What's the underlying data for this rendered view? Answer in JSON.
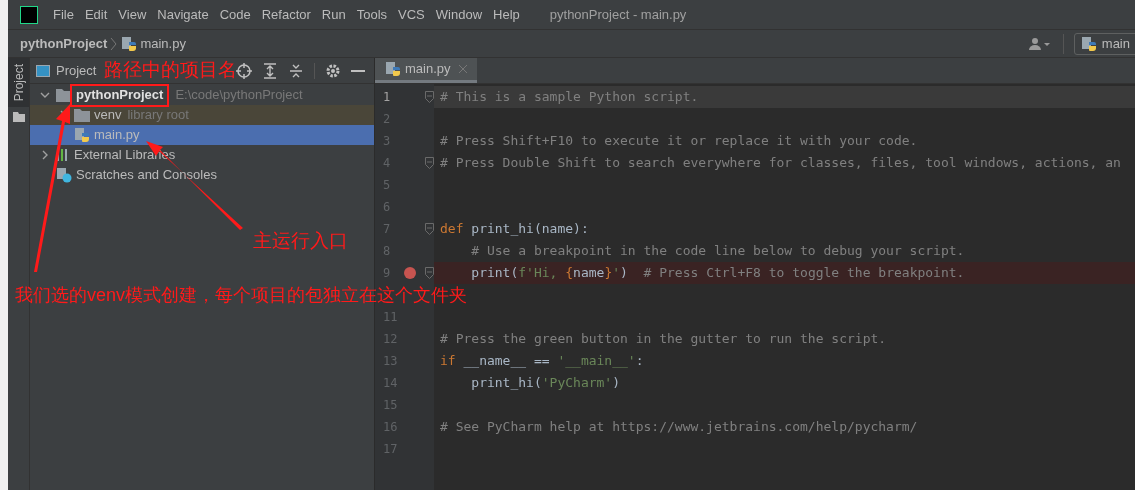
{
  "menu": [
    "File",
    "Edit",
    "View",
    "Navigate",
    "Code",
    "Refactor",
    "Run",
    "Tools",
    "VCS",
    "Window",
    "Help"
  ],
  "window": {
    "title": "pythonProject - main.py"
  },
  "breadcrumb": {
    "project": "pythonProject",
    "file": "main.py",
    "run_config": "main"
  },
  "project_panel": {
    "tool_tab": "Project",
    "title": "Project",
    "tree": [
      {
        "kind": "project",
        "label": "pythonProject",
        "hint": "E:\\code\\pythonProject",
        "selected": false,
        "expanded": true,
        "children": [
          {
            "kind": "folder",
            "label": "venv",
            "hint": "library root",
            "selected": false,
            "expanded": false,
            "color": "#4a4639"
          },
          {
            "kind": "file",
            "label": "main.py",
            "selected": true
          }
        ]
      },
      {
        "kind": "libraries",
        "label": "External Libraries",
        "selected": false,
        "expanded": false
      },
      {
        "kind": "scratches",
        "label": "Scratches and Consoles",
        "selected": false
      }
    ]
  },
  "editor": {
    "tabs": [
      {
        "label": "main.py",
        "selected": true
      }
    ],
    "lines": [
      {
        "number": "1",
        "current": true,
        "breakpoint": false,
        "fold": true,
        "tokens": [
          {
            "kind": "comment",
            "text": "# This is a sample Python script."
          }
        ]
      },
      {
        "number": "2",
        "current": false,
        "breakpoint": false,
        "fold": false
      },
      {
        "number": "3",
        "current": false,
        "breakpoint": false,
        "fold": false,
        "tokens": [
          {
            "kind": "comment",
            "text": "# Press Shift+F10 to execute it or replace it with your code."
          }
        ]
      },
      {
        "number": "4",
        "current": false,
        "breakpoint": false,
        "fold": true,
        "tokens": [
          {
            "kind": "comment",
            "text": "# Press Double Shift to search everywhere for classes, files, tool windows, actions, an"
          }
        ]
      },
      {
        "number": "5",
        "current": false,
        "breakpoint": false,
        "fold": false
      },
      {
        "number": "6",
        "current": false,
        "breakpoint": false,
        "fold": false
      },
      {
        "number": "7",
        "current": false,
        "breakpoint": false,
        "fold": true,
        "tokens": [
          {
            "kind": "keyword",
            "text": "def "
          },
          {
            "kind": "plain",
            "text": "print_hi(name):"
          }
        ]
      },
      {
        "number": "8",
        "current": false,
        "breakpoint": false,
        "fold": false,
        "tokens": [
          {
            "kind": "comment",
            "text": "    # Use a breakpoint in the code line below to debug your script."
          }
        ]
      },
      {
        "number": "9",
        "current": false,
        "breakpoint": true,
        "fold": true,
        "tokens": [
          {
            "kind": "plain",
            "text": "    print("
          },
          {
            "kind": "string",
            "text": "f'Hi, "
          },
          {
            "kind": "keyword",
            "text": "{"
          },
          {
            "kind": "plain",
            "text": "name"
          },
          {
            "kind": "keyword",
            "text": "}"
          },
          {
            "kind": "string",
            "text": "'"
          },
          {
            "kind": "plain",
            "text": ")  "
          },
          {
            "kind": "comment",
            "text": "# Press Ctrl+F8 to toggle the breakpoint."
          }
        ]
      },
      {
        "current": false,
        "breakpoint": false,
        "fold": false
      },
      {
        "number": "11",
        "current": false,
        "breakpoint": false,
        "fold": false
      },
      {
        "number": "12",
        "current": false,
        "breakpoint": false,
        "fold": false,
        "tokens": [
          {
            "kind": "comment",
            "text": "# Press the green button in the gutter to run the script."
          }
        ]
      },
      {
        "number": "13",
        "current": false,
        "breakpoint": false,
        "fold": false,
        "tokens": [
          {
            "kind": "keyword",
            "text": "if "
          },
          {
            "kind": "plain",
            "text": "__name__ == "
          },
          {
            "kind": "string",
            "text": "'__main__'"
          },
          {
            "kind": "plain",
            "text": ":"
          }
        ]
      },
      {
        "number": "14",
        "current": false,
        "breakpoint": false,
        "fold": false,
        "tokens": [
          {
            "kind": "plain",
            "text": "    print_hi("
          },
          {
            "kind": "string",
            "text": "'PyCharm'"
          },
          {
            "kind": "plain",
            "text": ")"
          }
        ]
      },
      {
        "number": "15",
        "current": false,
        "breakpoint": false,
        "fold": false
      },
      {
        "number": "16",
        "current": false,
        "breakpoint": false,
        "fold": false,
        "tokens": [
          {
            "kind": "comment",
            "text": "# See PyCharm help at https://www.jetbrains.com/help/pycharm/"
          }
        ]
      },
      {
        "number": "17",
        "current": false,
        "breakpoint": false,
        "fold": false
      }
    ]
  },
  "annotations": {
    "project_name_note": "路径中的项目名",
    "entry_note": "主运行入口",
    "venv_note": "我们选的venv模式创建，每个项目的包独立在这个文件夹"
  }
}
